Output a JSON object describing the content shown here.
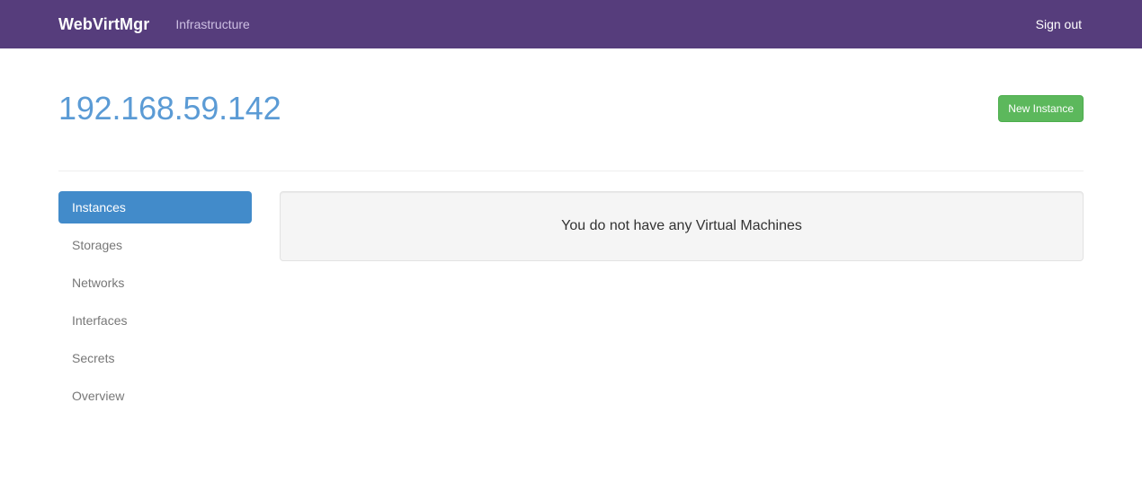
{
  "navbar": {
    "brand": "WebVirtMgr",
    "links": [
      {
        "label": "Infrastructure",
        "name": "nav-link-infrastructure"
      }
    ],
    "right_links": [
      {
        "label": "Sign out",
        "name": "nav-link-sign-out"
      }
    ],
    "background_color": "#563d7c"
  },
  "header": {
    "title": "192.168.59.142",
    "title_color": "#5b9bd5",
    "new_instance_label": "New Instance",
    "new_instance_color": "#5cb85c"
  },
  "sidebar": {
    "items": [
      {
        "label": "Instances",
        "active": true
      },
      {
        "label": "Storages",
        "active": false
      },
      {
        "label": "Networks",
        "active": false
      },
      {
        "label": "Interfaces",
        "active": false
      },
      {
        "label": "Secrets",
        "active": false
      },
      {
        "label": "Overview",
        "active": false
      }
    ],
    "active_color": "#428bca"
  },
  "main": {
    "empty_message": "You do not have any Virtual Machines",
    "panel_background": "#f5f5f5"
  }
}
